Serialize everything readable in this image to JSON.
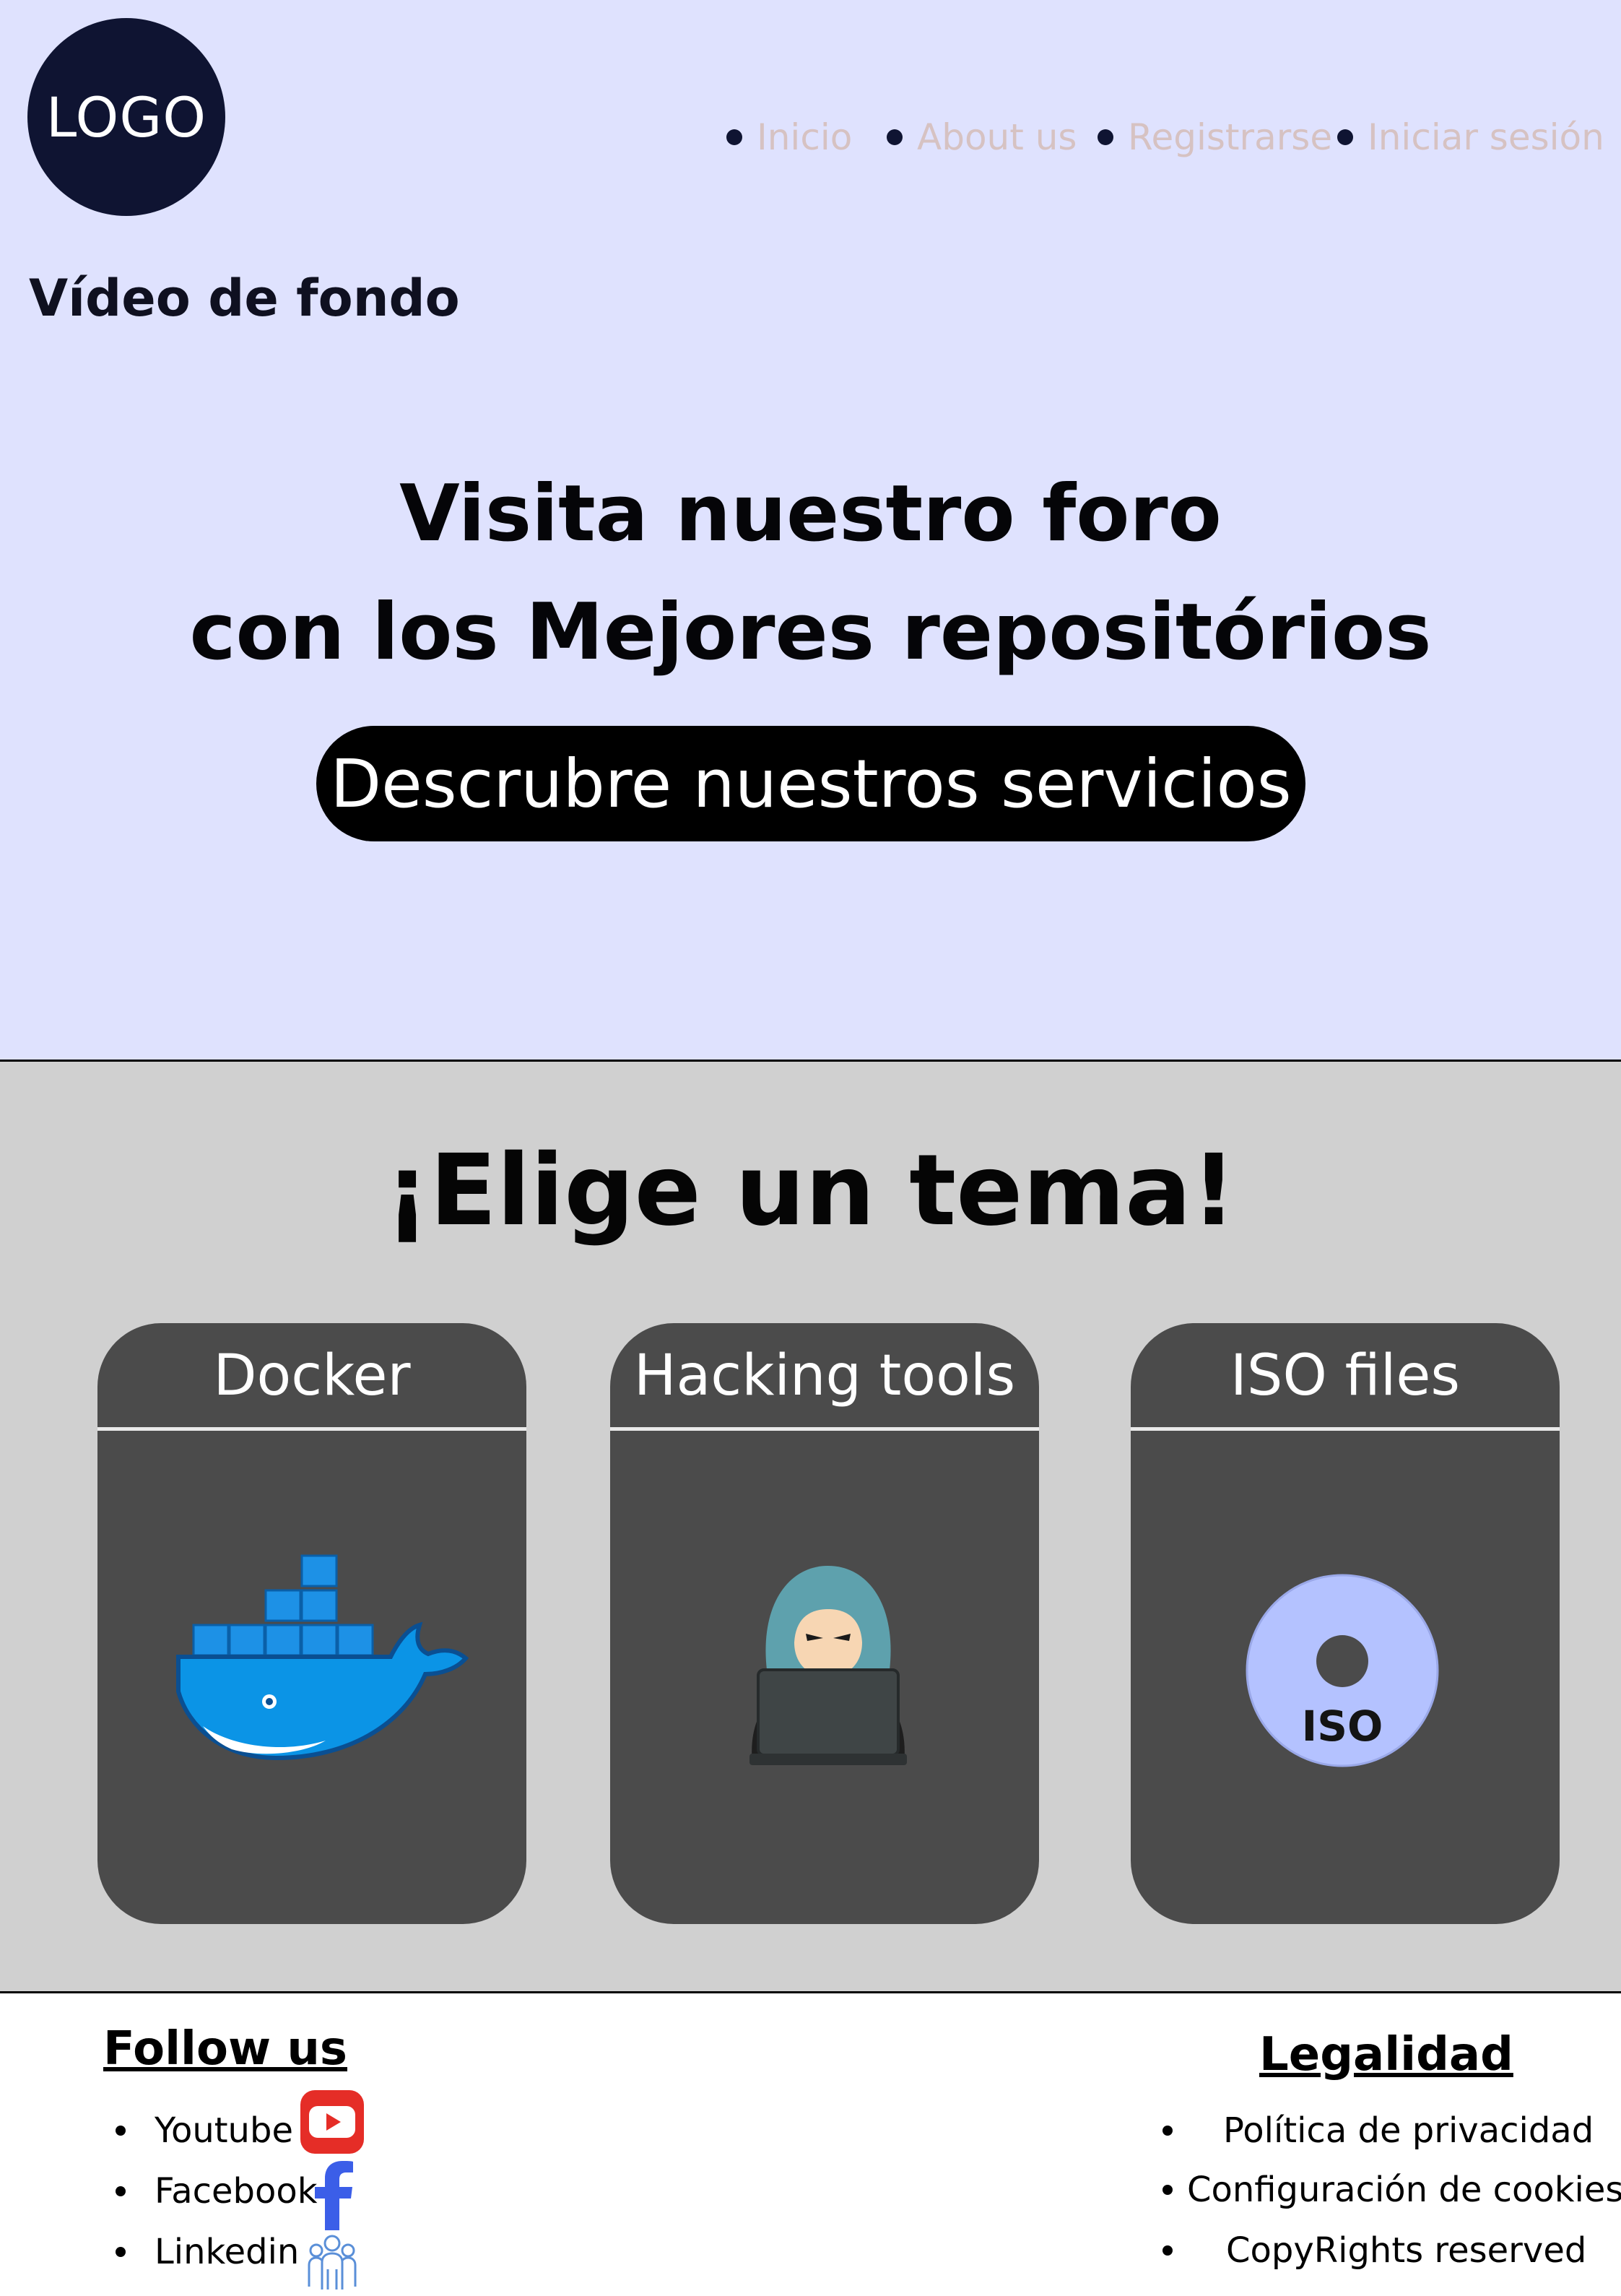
{
  "header": {
    "logo_text": "LOGO",
    "nav": [
      "Inicio",
      "About us",
      "Registrarse",
      "Iniciar sesión"
    ],
    "nav_color": "#d6c2c2"
  },
  "hero": {
    "background_label": "Vídeo de fondo",
    "title_line1": "Visita nuestro foro",
    "title_line2": "con los Mejores repositórios",
    "cta_label": "Descrubre nuestros servicios",
    "background_color": "#dfe2fe"
  },
  "topics": {
    "title": "¡Elige un tema!",
    "cards": [
      {
        "title": "Docker",
        "icon": "docker-whale-icon"
      },
      {
        "title": "Hacking tools",
        "icon": "hacker-icon"
      },
      {
        "title": "ISO files",
        "icon": "iso-disc-icon",
        "icon_text": "ISO"
      }
    ],
    "background_color": "#d0d0d0",
    "card_color": "#4b4b4b"
  },
  "footer": {
    "follow_heading": "Follow us",
    "social": [
      {
        "label": "Youtube",
        "icon": "youtube-icon"
      },
      {
        "label": "Facebook",
        "icon": "facebook-icon"
      },
      {
        "label": "Linkedin",
        "icon": "linkedin-icon"
      }
    ],
    "legal_heading": "Legalidad",
    "legal": [
      "Política de privacidad",
      "Configuración de cookies",
      "CopyRights reserved"
    ]
  }
}
